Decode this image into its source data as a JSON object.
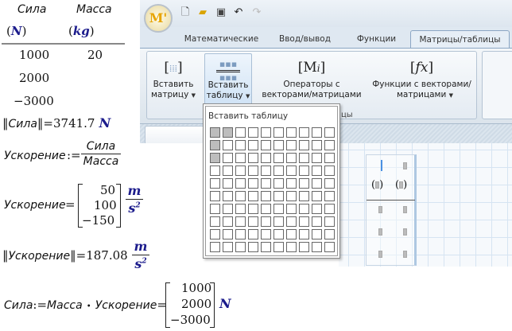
{
  "worksheet": {
    "table": {
      "headers": [
        "Сила",
        "Масса"
      ],
      "units": [
        "N",
        "kg"
      ],
      "col1": [
        "1000",
        "2000",
        "−3000"
      ],
      "col2": [
        "20"
      ]
    },
    "norm_force": {
      "var": "Сила",
      "eq": "=",
      "value": "3741.7",
      "unit": "N"
    },
    "accel_def": {
      "var": "Ускорение",
      "assign": ":=",
      "num": "Сила",
      "den": "Масса"
    },
    "accel_eval": {
      "var": "Ускорение",
      "eq": "=",
      "values": [
        "50",
        "100",
        "−150"
      ],
      "unit_num": "m",
      "unit_den": "s",
      "unit_exp": "2"
    },
    "norm_accel": {
      "var": "Ускорение",
      "eq": "=",
      "value": "187.08",
      "unit_num": "m",
      "unit_den": "s",
      "unit_exp": "2"
    },
    "force_redef": {
      "lhs": "Сила",
      "assign": ":=",
      "a": "Масса",
      "dot": "•",
      "b": "Ускорение",
      "eq": "=",
      "values": [
        "1000",
        "2000",
        "−3000"
      ],
      "unit": "N"
    }
  },
  "app": {
    "logo": "M'",
    "tabs": [
      "Математические",
      "Ввод/вывод",
      "Функции",
      "Матрицы/таблицы"
    ],
    "active_tab": "Матрицы/таблицы",
    "ribbon": {
      "buttons": [
        {
          "line1": "Вставить",
          "line2": "матрицу"
        },
        {
          "line1": "Вставить",
          "line2": "таблицу"
        },
        {
          "line1": "Операторы с",
          "line2": "векторами/матрицами",
          "icon": "Mi"
        },
        {
          "line1": "Функции с векторами/",
          "line2": "матрицами",
          "icon": "fx"
        }
      ],
      "group_label_visible": "цы"
    },
    "dropdown": {
      "title": "Вставить таблицу",
      "rows": 10,
      "cols": 10,
      "selected_cells": [
        [
          0,
          0
        ],
        [
          0,
          1
        ],
        [
          1,
          0
        ],
        [
          2,
          0
        ]
      ]
    }
  },
  "colors": {
    "unit": "#1c1c8c",
    "accent": "#8ba6c4"
  }
}
